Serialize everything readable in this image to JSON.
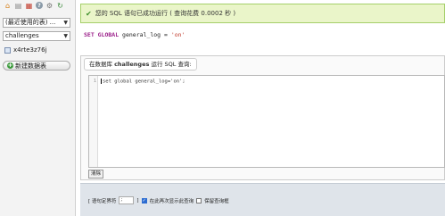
{
  "sidebar": {
    "icons": [
      {
        "name": "home-icon",
        "glyph": "⌂"
      },
      {
        "name": "logout-icon",
        "glyph": "▤"
      },
      {
        "name": "database-icon",
        "glyph": "▦"
      },
      {
        "name": "help-icon",
        "glyph": "?"
      },
      {
        "name": "settings-icon",
        "glyph": "⚙"
      },
      {
        "name": "reload-icon",
        "glyph": "↻"
      }
    ],
    "recent_tables_select": "(最近使用的表) ...",
    "database_select": "challenges",
    "tables": [
      "x4rte3z76j"
    ],
    "new_table_label": "新建数据表"
  },
  "main": {
    "success_message": "您的 SQL 语句已成功运行 ( 查询花费 0.0002 秒 )",
    "executed_sql": {
      "keyword": "SET GLOBAL",
      "rest": " general_log = ",
      "value": "'on'"
    },
    "query_box": {
      "legend_prefix": "在数据库",
      "legend_db": "challenges",
      "legend_suffix": "运行 SQL 查询:",
      "line_number": "1",
      "code": "set global general_log='on';",
      "clear_label": "清除"
    },
    "options": {
      "delimiter_label": "[ 语句定界符",
      "delimiter_value": ";",
      "delimiter_close": "]",
      "show_again_label": "在此再次显示此查询",
      "show_again_checked": true,
      "keep_box_label": "保留查询框",
      "keep_box_checked": false
    }
  },
  "colors": {
    "success_bg": "#eaf5c9",
    "keyword": "#9b1f8a",
    "string": "#c0392b",
    "options_bg": "#dfe4ea"
  }
}
